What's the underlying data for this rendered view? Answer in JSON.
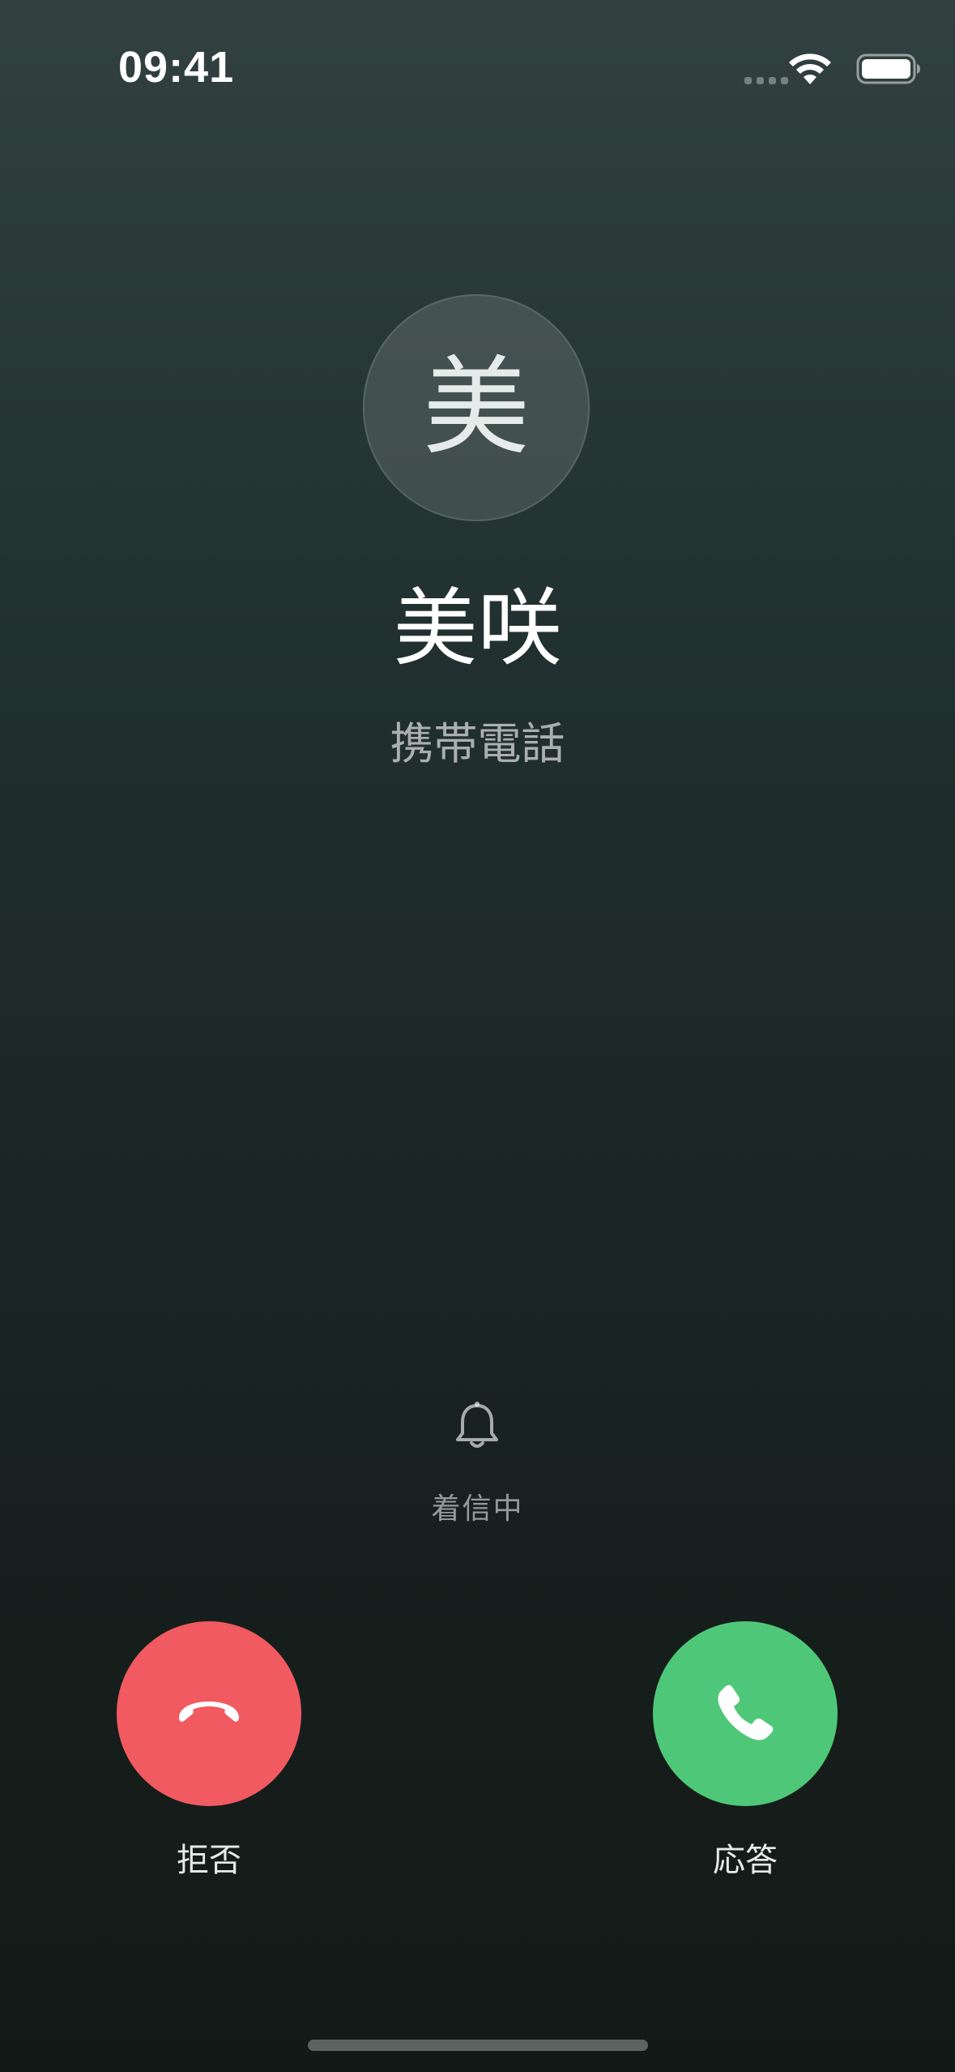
{
  "status_bar": {
    "time": "09:41",
    "icons": [
      "cellular-signal-icon",
      "wifi-icon",
      "battery-icon"
    ]
  },
  "caller": {
    "initial": "美",
    "name": "美咲",
    "label": "携帯電話"
  },
  "ringing": {
    "icon": "bell-icon",
    "status": "着信中"
  },
  "actions": {
    "decline_label": "拒否",
    "answer_label": "応答"
  },
  "colors": {
    "decline": "#f15a60",
    "answer": "#4ec878",
    "background_top": "#324140",
    "background_bottom": "#131917"
  }
}
